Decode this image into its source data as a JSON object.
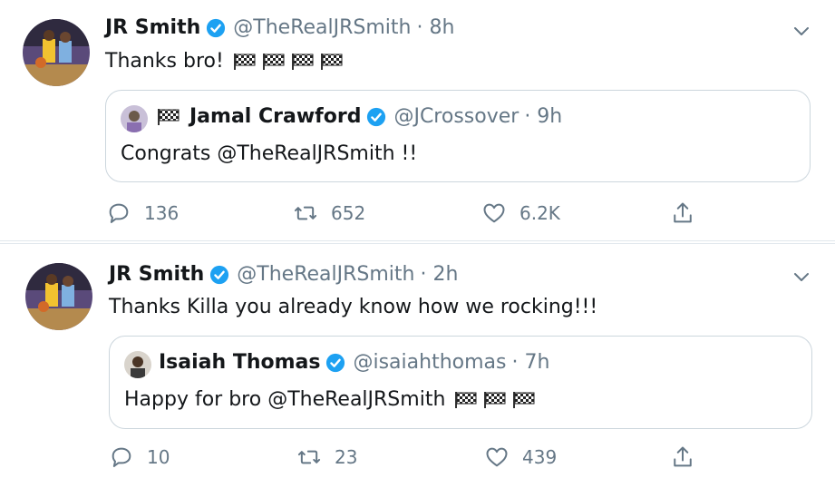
{
  "tweets": [
    {
      "author": {
        "name": "JR Smith",
        "handle": "@TheRealJRSmith",
        "time": "· 8h",
        "avatar": "basketball-player-avatar"
      },
      "text": "Thanks bro!",
      "emoji": [
        "checkered-flag",
        "checkered-flag",
        "checkered-flag",
        "checkered-flag"
      ],
      "quote": {
        "author": {
          "name": "Jamal Crawford",
          "handle": "@JCrossover",
          "time": "· 9h",
          "avatar": "portrait-avatar"
        },
        "name_prefix_emoji": "checkered-flag",
        "text": "Congrats @TheRealJRSmith !!",
        "emoji": []
      },
      "stats": {
        "replies": "136",
        "retweets": "652",
        "likes": "6.2K"
      }
    },
    {
      "author": {
        "name": "JR Smith",
        "handle": "@TheRealJRSmith",
        "time": "· 2h",
        "avatar": "basketball-player-avatar"
      },
      "text": "Thanks Killa you already know how we rocking!!!",
      "emoji": [],
      "quote": {
        "author": {
          "name": "Isaiah Thomas",
          "handle": "@isaiahthomas",
          "time": "· 7h",
          "avatar": "portrait-avatar"
        },
        "text": "Happy for bro @TheRealJRSmith",
        "emoji": [
          "checkered-flag",
          "checkered-flag",
          "checkered-flag"
        ]
      },
      "stats": {
        "replies": "10",
        "retweets": "23",
        "likes": "439"
      }
    }
  ],
  "colors": {
    "verified": "#1da1f2",
    "secondary_text": "#657786",
    "border": "#ccd6dd"
  }
}
